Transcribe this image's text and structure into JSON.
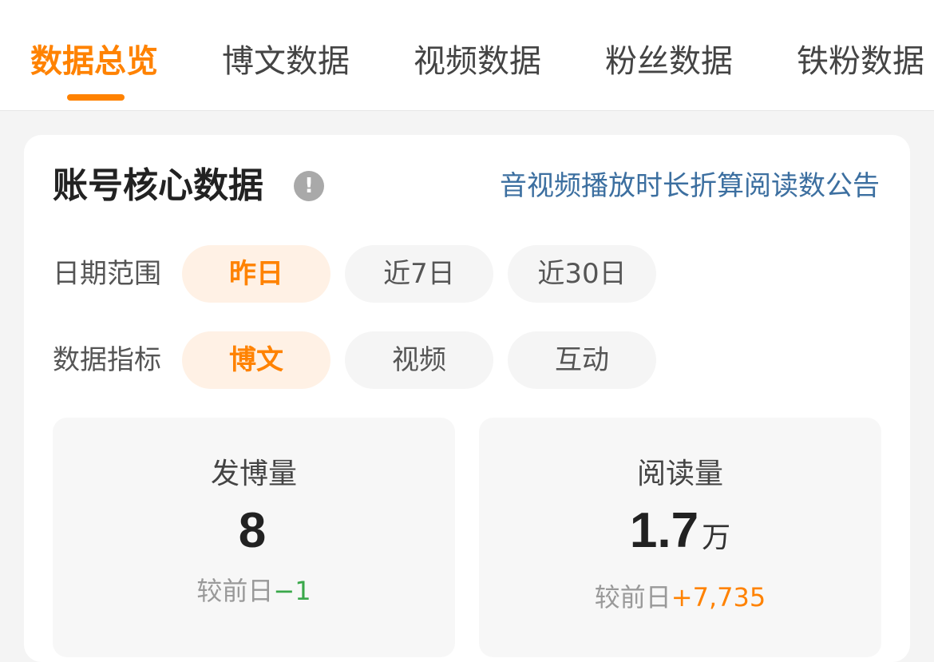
{
  "tabs": [
    {
      "label": "数据总览",
      "active": true
    },
    {
      "label": "博文数据",
      "active": false
    },
    {
      "label": "视频数据",
      "active": false
    },
    {
      "label": "粉丝数据",
      "active": false
    },
    {
      "label": "铁粉数据",
      "active": false
    }
  ],
  "card": {
    "title": "账号核心数据",
    "info_icon": "exclamation-icon",
    "info_glyph": "!",
    "notice_link": "音视频播放时长折算阅读数公告"
  },
  "date_filter": {
    "label": "日期范围",
    "options": [
      "昨日",
      "近7日",
      "近30日"
    ],
    "selected": "昨日"
  },
  "metric_filter": {
    "label": "数据指标",
    "options": [
      "博文",
      "视频",
      "互动"
    ],
    "selected": "博文"
  },
  "stats": [
    {
      "label": "发博量",
      "value": "8",
      "unit": "",
      "compare_label": "较前日",
      "delta": "−1",
      "delta_color": "#3aa84a"
    },
    {
      "label": "阅读量",
      "value": "1.7",
      "unit": "万",
      "compare_label": "较前日",
      "delta": "+7,735",
      "delta_color": "#ff8200"
    }
  ],
  "colors": {
    "accent": "#ff8200",
    "link": "#3c6fa0",
    "positive": "#ff8200",
    "negative": "#3aa84a"
  }
}
